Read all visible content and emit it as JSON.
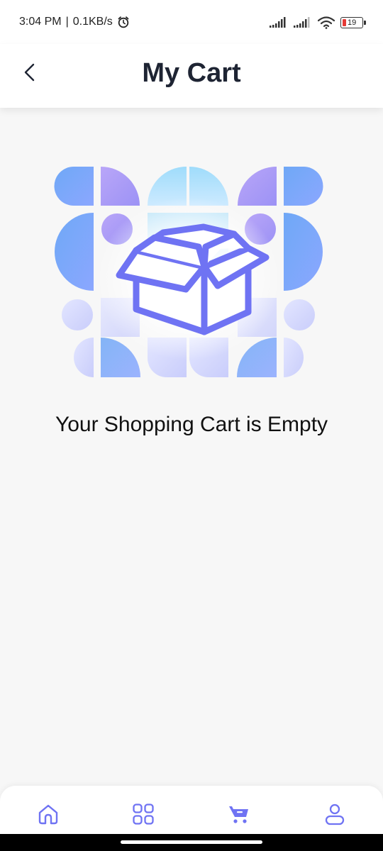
{
  "status_bar": {
    "time": "3:04 PM",
    "separator": "|",
    "speed": "0.1KB/s",
    "battery_level": "19",
    "icons": [
      "alarm-icon",
      "signal-icon",
      "signal-icon",
      "wifi-icon",
      "battery-icon"
    ]
  },
  "header": {
    "title": "My Cart",
    "back_icon": "chevron-left-icon"
  },
  "empty_state": {
    "message": "Your Shopping Cart is Empty",
    "illustration_icon": "open-box-icon"
  },
  "bottom_nav": {
    "items": [
      {
        "icon": "home-icon",
        "active": false
      },
      {
        "icon": "grid-icon",
        "active": false
      },
      {
        "icon": "cart-icon",
        "active": true
      },
      {
        "icon": "user-icon",
        "active": false
      }
    ]
  },
  "colors": {
    "accent": "#6f73f3",
    "title": "#1e2433",
    "background": "#f7f7f7"
  }
}
